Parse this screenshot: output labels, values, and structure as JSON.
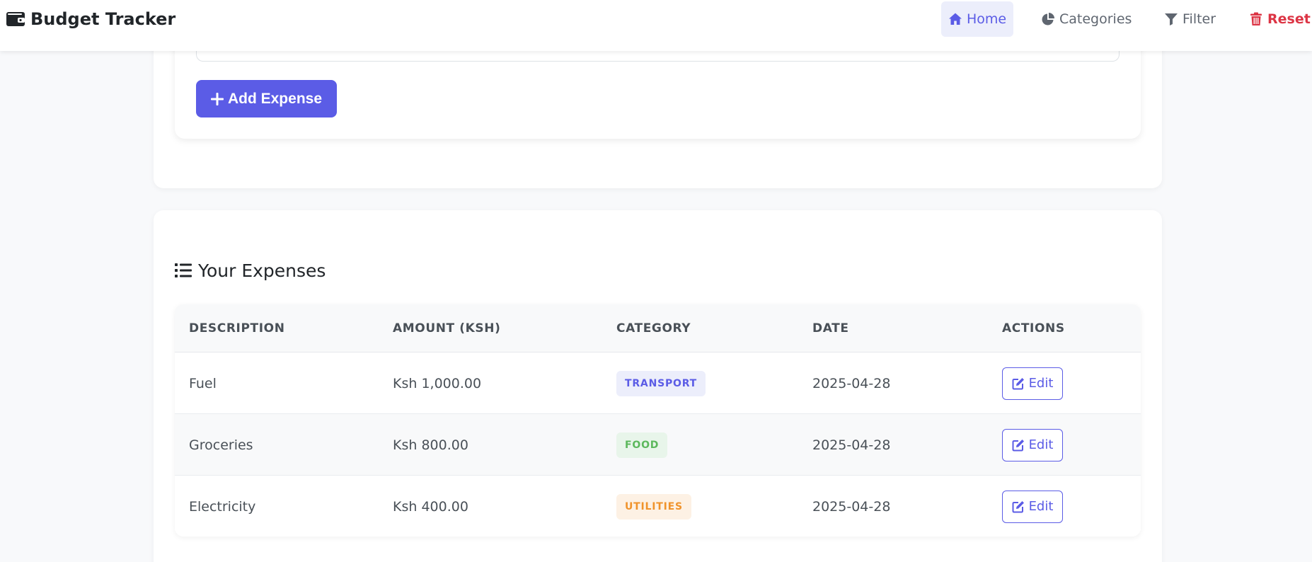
{
  "brand": {
    "title": "Budget Tracker",
    "icon": "wallet-icon"
  },
  "nav": {
    "items": [
      {
        "label": "Home",
        "icon": "home-icon",
        "active": true
      },
      {
        "label": "Categories",
        "icon": "pie-chart-icon",
        "active": false
      },
      {
        "label": "Filter",
        "icon": "filter-icon",
        "active": false
      },
      {
        "label": "Reset",
        "icon": "trash-icon",
        "active": false
      }
    ]
  },
  "form": {
    "add_button_label": "Add Expense",
    "add_icon": "plus-icon"
  },
  "expenses": {
    "title": "Your Expenses",
    "title_icon": "list-icon",
    "columns": [
      "DESCRIPTION",
      "AMOUNT (KSH)",
      "CATEGORY",
      "DATE",
      "ACTIONS"
    ],
    "rows": [
      {
        "description": "Fuel",
        "amount": "Ksh 1,000.00",
        "category": "TRANSPORT",
        "date": "2025-04-28",
        "action": "Edit"
      },
      {
        "description": "Groceries",
        "amount": "Ksh 800.00",
        "category": "FOOD",
        "date": "2025-04-28",
        "action": "Edit"
      },
      {
        "description": "Electricity",
        "amount": "Ksh 400.00",
        "category": "UTILITIES",
        "date": "2025-04-28",
        "action": "Edit"
      }
    ]
  },
  "colors": {
    "primary": "#5b5ce6",
    "danger": "#dc3545",
    "transport_bg": "#eceefb",
    "transport_fg": "#5b5ce6",
    "food_bg": "#e8f5ea",
    "food_fg": "#5cb85c",
    "utilities_bg": "#fdf1e4",
    "utilities_fg": "#f0932b"
  }
}
